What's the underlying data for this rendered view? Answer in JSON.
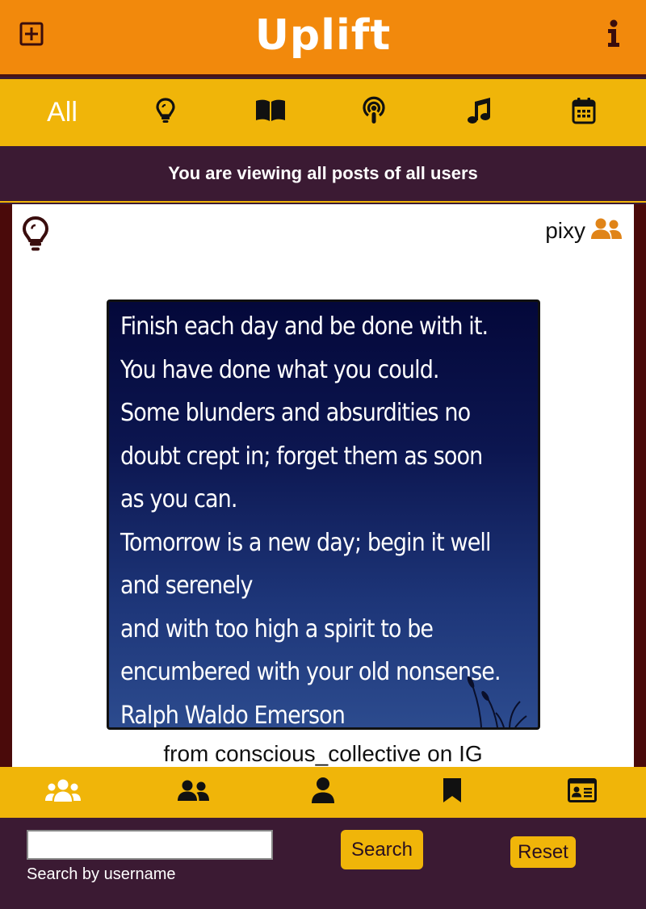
{
  "app": {
    "title": "Uplift",
    "add_icon": "add-square-icon",
    "info_icon": "info-icon"
  },
  "categories": [
    {
      "label": "All",
      "icon": null
    },
    {
      "label": "",
      "icon": "lightbulb-icon"
    },
    {
      "label": "",
      "icon": "book-icon"
    },
    {
      "label": "",
      "icon": "podcast-icon"
    },
    {
      "label": "",
      "icon": "music-icon"
    },
    {
      "label": "",
      "icon": "calendar-icon"
    }
  ],
  "banner": {
    "text": "You are viewing all posts of all users"
  },
  "post": {
    "type_icon": "lightbulb-icon",
    "author": "pixy",
    "author_icon": "users-icon",
    "quote_lines": [
      "Finish each day and be done with it.",
      "You have done what you could.",
      "Some blunders and absurdities no",
      "doubt crept in; forget them as soon",
      "as you can.",
      "Tomorrow is a new day; begin it well",
      "and serenely",
      "and with too high a spirit to be",
      "encumbered with your old nonsense.",
      "Ralph Waldo Emerson"
    ],
    "caption": "from conscious_collective on IG"
  },
  "bottom_nav": [
    {
      "icon": "all-users-icon"
    },
    {
      "icon": "group-icon"
    },
    {
      "icon": "user-icon"
    },
    {
      "icon": "bookmark-icon"
    },
    {
      "icon": "profile-card-icon"
    }
  ],
  "search": {
    "value": "",
    "placeholder": "",
    "hint": "Search by username",
    "search_label": "Search",
    "reset_label": "Reset"
  },
  "colors": {
    "header": "#f2890c",
    "accent": "#f0b509",
    "dark": "#3b1a33",
    "maroon": "#4a0a0a",
    "author_icon": "#e08418"
  }
}
